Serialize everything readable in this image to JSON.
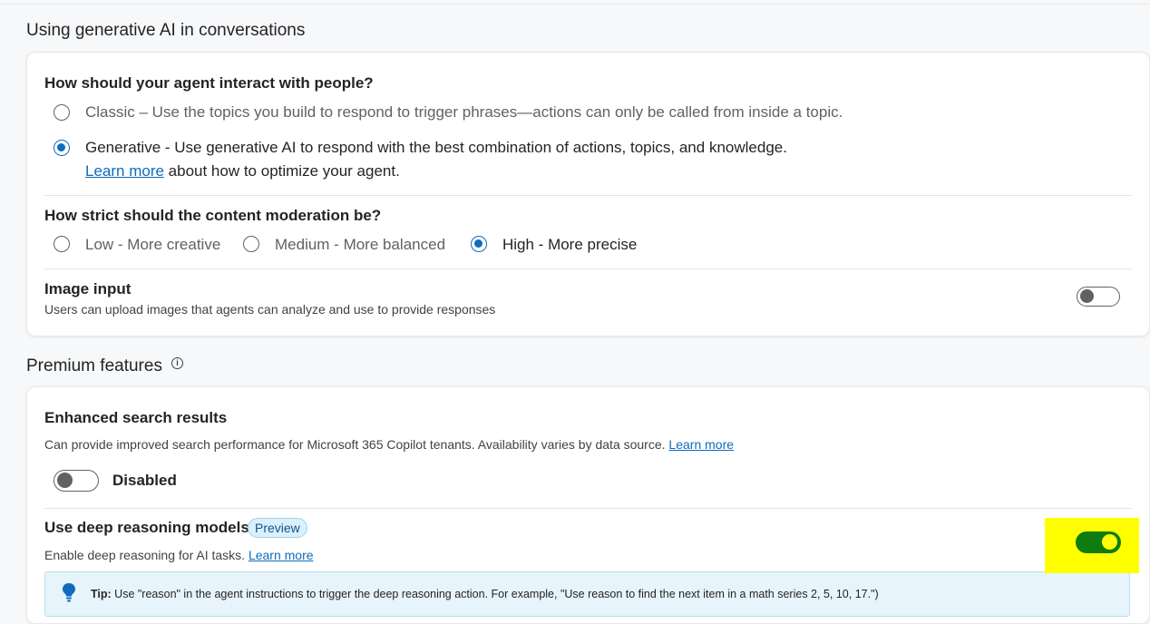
{
  "section1": {
    "title": "Using generative AI in conversations"
  },
  "interaction": {
    "question": "How should your agent interact with people?",
    "classic_label": "Classic – Use the topics you build to respond to trigger phrases—actions can only be called from inside a topic.",
    "generative_label": "Generative - Use generative AI to respond with the best combination of actions, topics, and knowledge.",
    "learn_more": "Learn more",
    "learn_more_suffix": " about how to optimize your agent.",
    "selected": "Generative"
  },
  "moderation": {
    "question": "How strict should the content moderation be?",
    "options": [
      "Low - More creative",
      "Medium - More balanced",
      "High - More precise"
    ],
    "selected": "High - More precise"
  },
  "image_input": {
    "title": "Image input",
    "description": "Users can upload images that agents can analyze and use to provide responses",
    "enabled": false
  },
  "section2": {
    "title": "Premium features"
  },
  "enhanced_search": {
    "title": "Enhanced search results",
    "description": "Can provide improved search performance for Microsoft 365 Copilot tenants. Availability varies by data source.",
    "learn_more": "Learn more",
    "toggle_label": "Disabled",
    "enabled": false
  },
  "deep_reasoning": {
    "title": "Use deep reasoning models",
    "badge": "Preview",
    "description": "Enable deep reasoning for AI tasks.",
    "learn_more": "Learn more",
    "enabled": true,
    "highlight_color": "#ffff00"
  },
  "tip": {
    "label": "Tip:",
    "text": " Use \"reason\" in the agent instructions to trigger the deep reasoning action. For example, \"Use reason to find the next item in a math series 2, 5, 10, 17.\")"
  },
  "colors": {
    "accent": "#0f6cbd",
    "toggle_on": "#107c10",
    "tip_bg": "#e7f4fb"
  }
}
